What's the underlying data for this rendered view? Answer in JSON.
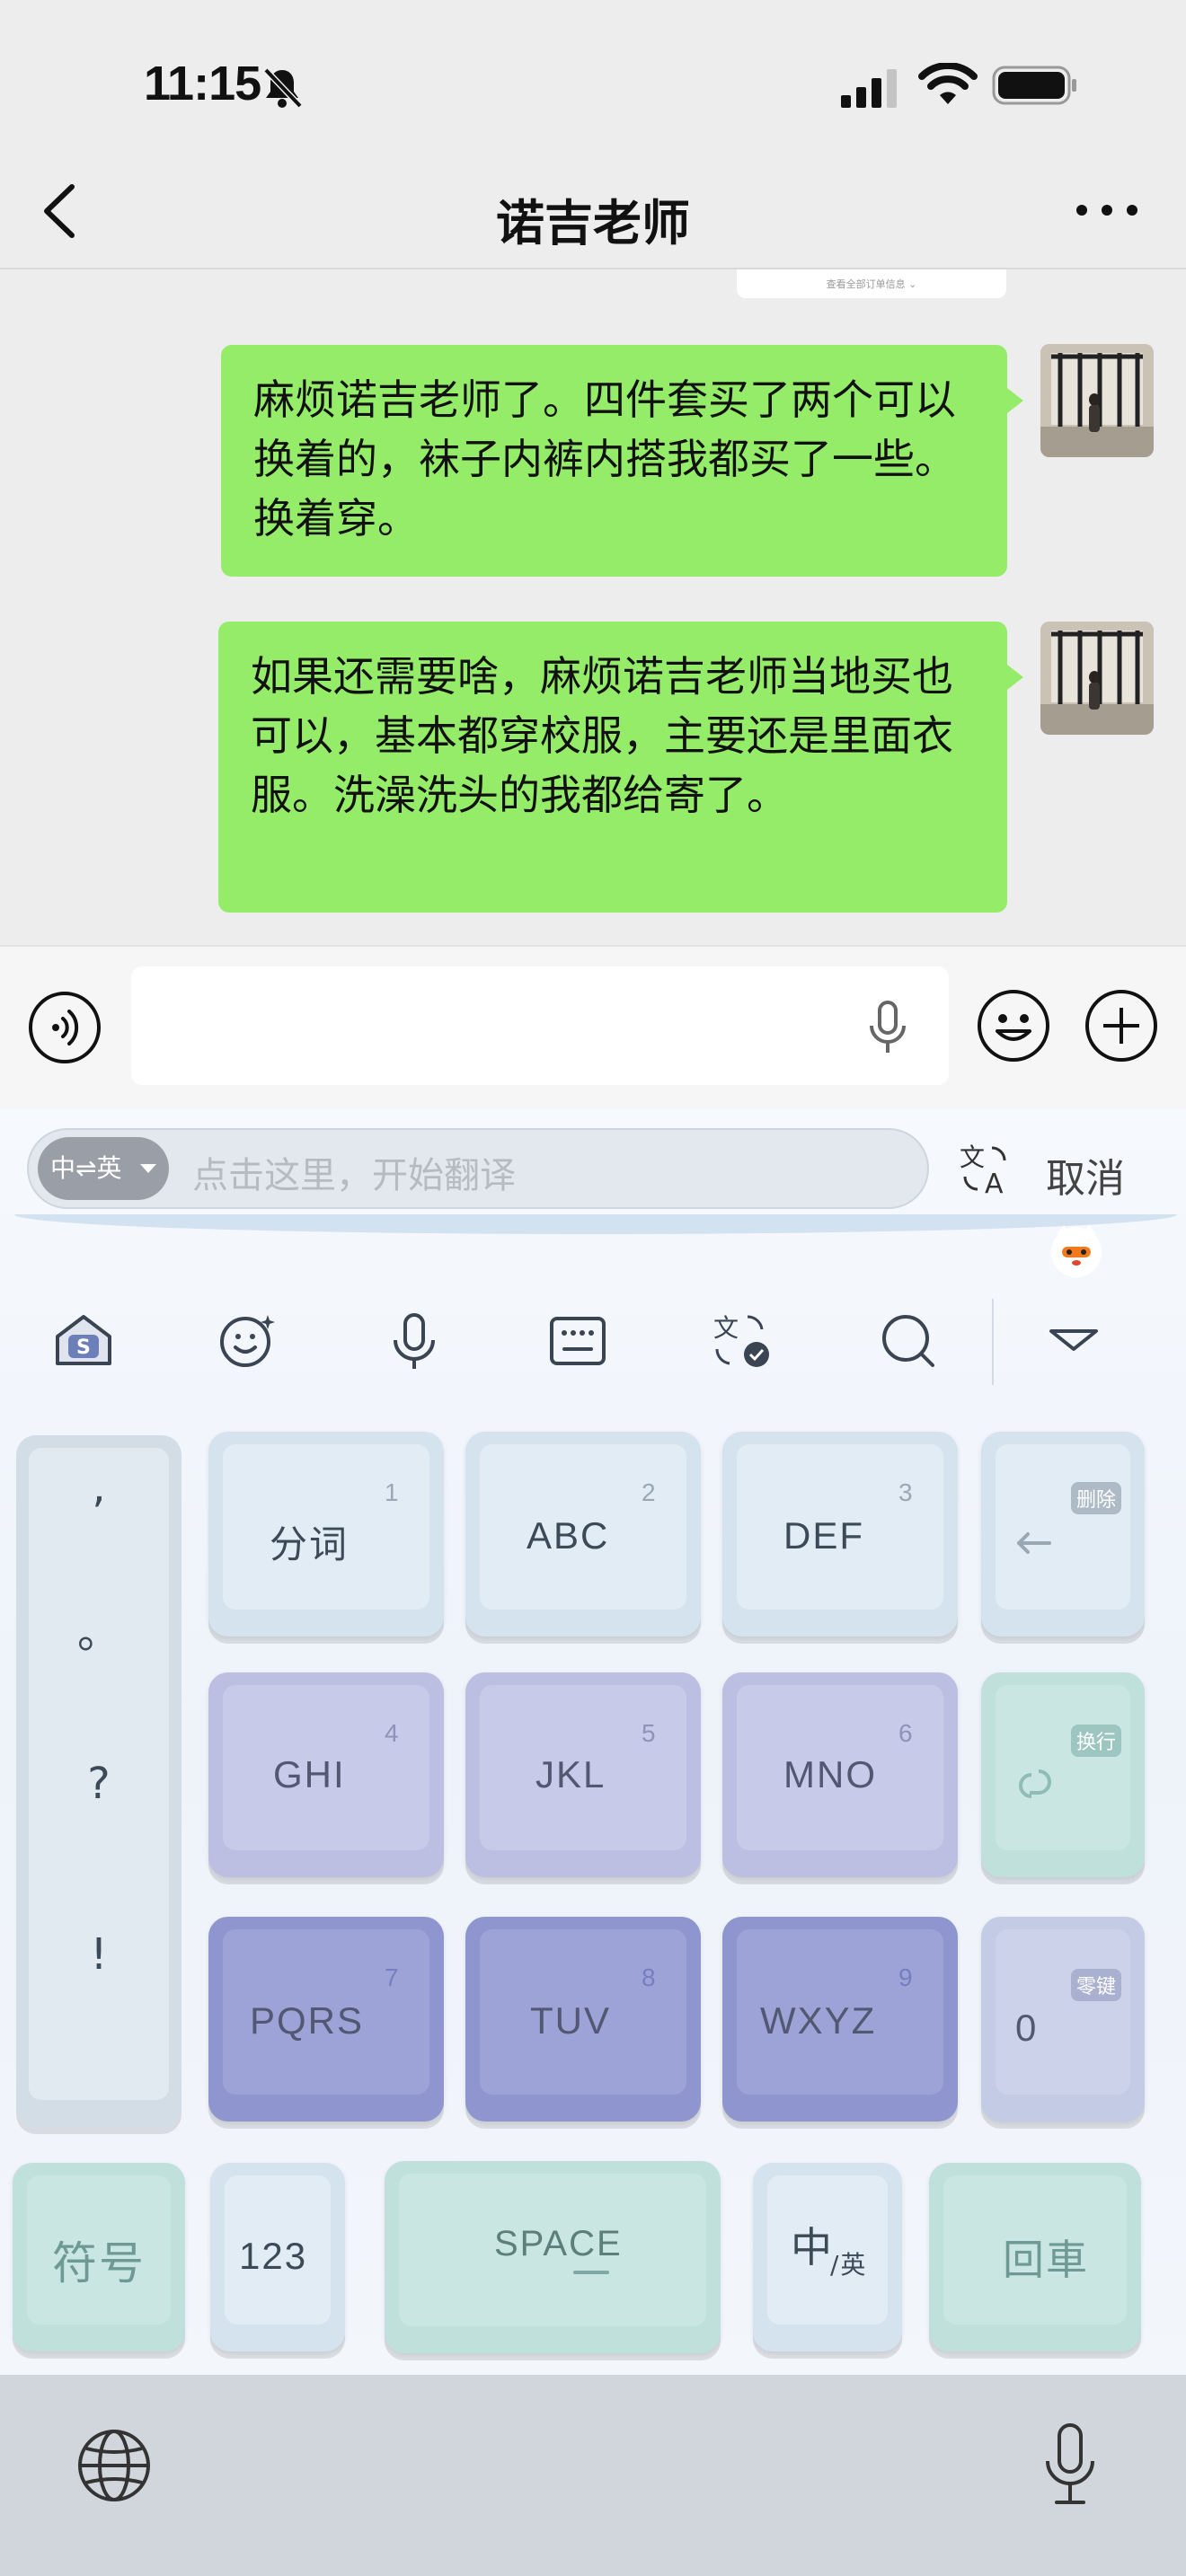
{
  "status_bar": {
    "time": "11:15"
  },
  "header": {
    "title": "诺吉老师"
  },
  "order_card": {
    "text": "查看全部订单信息 ⌄"
  },
  "messages": [
    {
      "text": "麻烦诺吉老师了。四件套买了两个可以换着的，袜子内裤内搭我都买了一些。换着穿。"
    },
    {
      "text": "如果还需要啥，麻烦诺吉老师当地买也可以，基本都穿校服，主要还是里面衣服。洗澡洗头的我都给寄了。"
    }
  ],
  "translate_bar": {
    "lang_label": "中⇌英",
    "placeholder": "点击这里，开始翻译",
    "cancel_label": "取消"
  },
  "keyboard": {
    "punctuation": [
      ",",
      "。",
      "?",
      "!"
    ],
    "keys": {
      "k1": {
        "label": "分词",
        "num": "1"
      },
      "k2": {
        "label": "ABC",
        "num": "2"
      },
      "k3": {
        "label": "DEF",
        "num": "3"
      },
      "k4": {
        "label": "GHI",
        "num": "4"
      },
      "k5": {
        "label": "JKL",
        "num": "5"
      },
      "k6": {
        "label": "MNO",
        "num": "6"
      },
      "k7": {
        "label": "PQRS",
        "num": "7"
      },
      "k8": {
        "label": "TUV",
        "num": "8"
      },
      "k9": {
        "label": "WXYZ",
        "num": "9"
      },
      "k0": {
        "label": "0",
        "badge": "零键"
      }
    },
    "delete_badge": "删除",
    "enter_badge": "换行",
    "symbol_label": "符号",
    "num_label": "123",
    "space_label": "SPACE",
    "lang_main": "中",
    "lang_sub": "/英",
    "return_label": "回車"
  }
}
